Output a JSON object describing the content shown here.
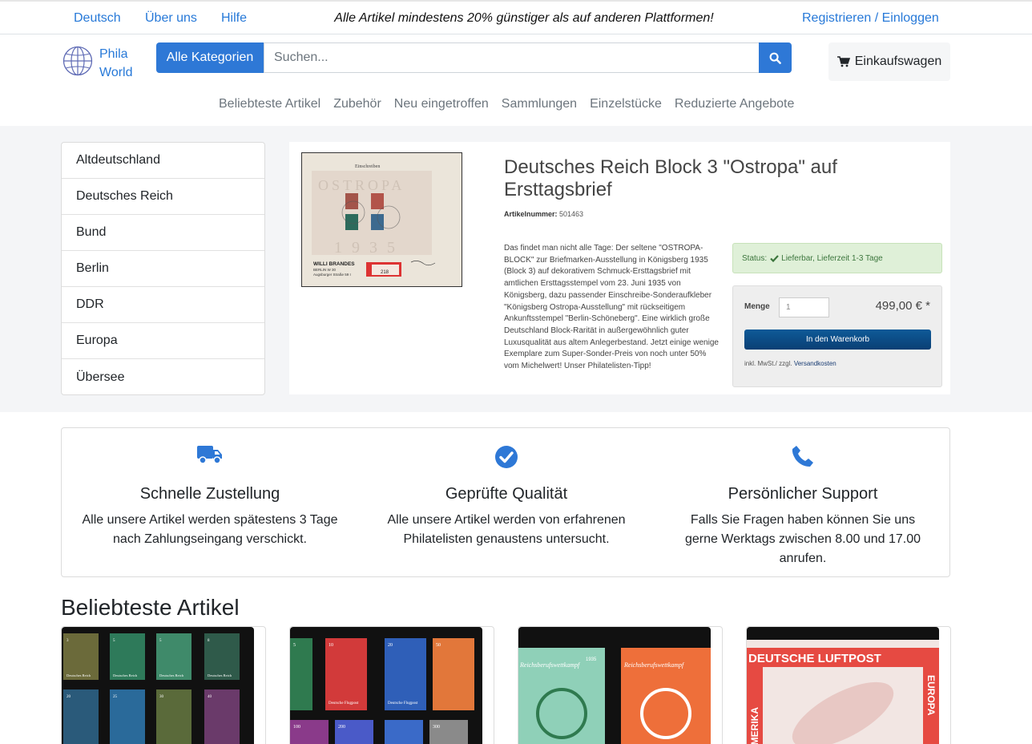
{
  "topbar": {
    "lang": "Deutsch",
    "about": "Über uns",
    "help": "Hilfe",
    "promo": "Alle Artikel mindestens 20% günstiger als auf anderen Plattformen!",
    "login": "Registrieren / Einloggen"
  },
  "header": {
    "logo_line1": "Phila",
    "logo_line2": "World",
    "all_categories": "Alle Kategorien",
    "search_placeholder": "Suchen...",
    "cart": "Einkaufswagen"
  },
  "nav": [
    "Beliebteste Artikel",
    "Zubehör",
    "Neu eingetroffen",
    "Sammlungen",
    "Einzelstücke",
    "Reduzierte Angebote"
  ],
  "categories": [
    "Altdeutschland",
    "Deutsches Reich",
    "Bund",
    "Berlin",
    "DDR",
    "Europa",
    "Übersee"
  ],
  "featured": {
    "title": "Deutsches Reich Block 3 \"Ostropa\" auf Ersttagsbrief",
    "artno_label": "Artikelnummer:",
    "artno": "501463",
    "description": "Das findet man nicht alle Tage: Der seltene \"OSTROPA-BLOCK\" zur Briefmarken-Ausstellung in Königsberg 1935 (Block 3) auf dekorativem Schmuck-Ersttagsbrief mit amtlichen Ersttagsstempel vom 23. Juni 1935 von Königsberg, dazu passender Einschreibe-Sonderaufkleber \"Königsberg Ostropa-Ausstellung\" mit rückseitigem Ankunftsstempel \"Berlin-Schöneberg\". Eine wirklich große Deutschland Block-Rarität in außergewöhnlich guter Luxusqualität aus altem Anlegerbestand. Jetzt einige wenige Exemplare zum Super-Sonder-Preis von noch unter 50% vom Michelwert! Unser Philatelisten-Tipp!",
    "status_label": "Status:",
    "status_text": "Lieferbar, Lieferzeit 1-3 Tage",
    "menge_label": "Menge",
    "menge_value": "1",
    "price": "499,00 € *",
    "add_to_cart": "In den Warenkorb",
    "vat_text": "inkl. MwSt./ zzgl.",
    "shipping_link": "Versandkosten",
    "image_text": {
      "einschreiben": "Einschreiben",
      "ostropa": "OSTROPA",
      "year": "1935",
      "sender": "WILLI BRANDES",
      "addr1": "BERLIN W 30",
      "addr2": "Augsburger Straße 59 I",
      "label_no": "218"
    }
  },
  "features": [
    {
      "icon": "truck-icon",
      "title": "Schnelle Zustellung",
      "text": "Alle unsere Artikel werden spätestens 3 Tage nach Zahlungseingang verschickt."
    },
    {
      "icon": "check-circle-icon",
      "title": "Geprüfte Qualität",
      "text": "Alle unsere Artikel werden von erfahrenen Philatelisten genaustens untersucht."
    },
    {
      "icon": "phone-icon",
      "title": "Persönlicher Support",
      "text": "Falls Sie Fragen haben können Sie uns gerne Werktags zwischen 8.00 und 17.00 anrufen."
    }
  ],
  "popular_title": "Beliebteste Artikel",
  "products": [
    {
      "stamp_text": "Deutsches Reich",
      "values": [
        "3",
        "5",
        "5",
        "8",
        "20",
        "25",
        "30",
        "40"
      ]
    },
    {
      "stamp_text": "Deutsche Flugpost",
      "values": [
        "5",
        "10",
        "20",
        "50",
        "100",
        "200",
        "300"
      ]
    },
    {
      "stamp_text": "Reichsberufswettkampf",
      "year": "1935"
    },
    {
      "stamp_text": "DEUTSCHE LUFTPOST",
      "side_left": "AMERIKA",
      "side_right": "EUROPA"
    }
  ],
  "colors": {
    "accent": "#2e78d6",
    "link": "#2779d8",
    "band": "#f4f5f7",
    "cart_btn": "#0a3f74",
    "status_bg": "#dff0d8"
  }
}
